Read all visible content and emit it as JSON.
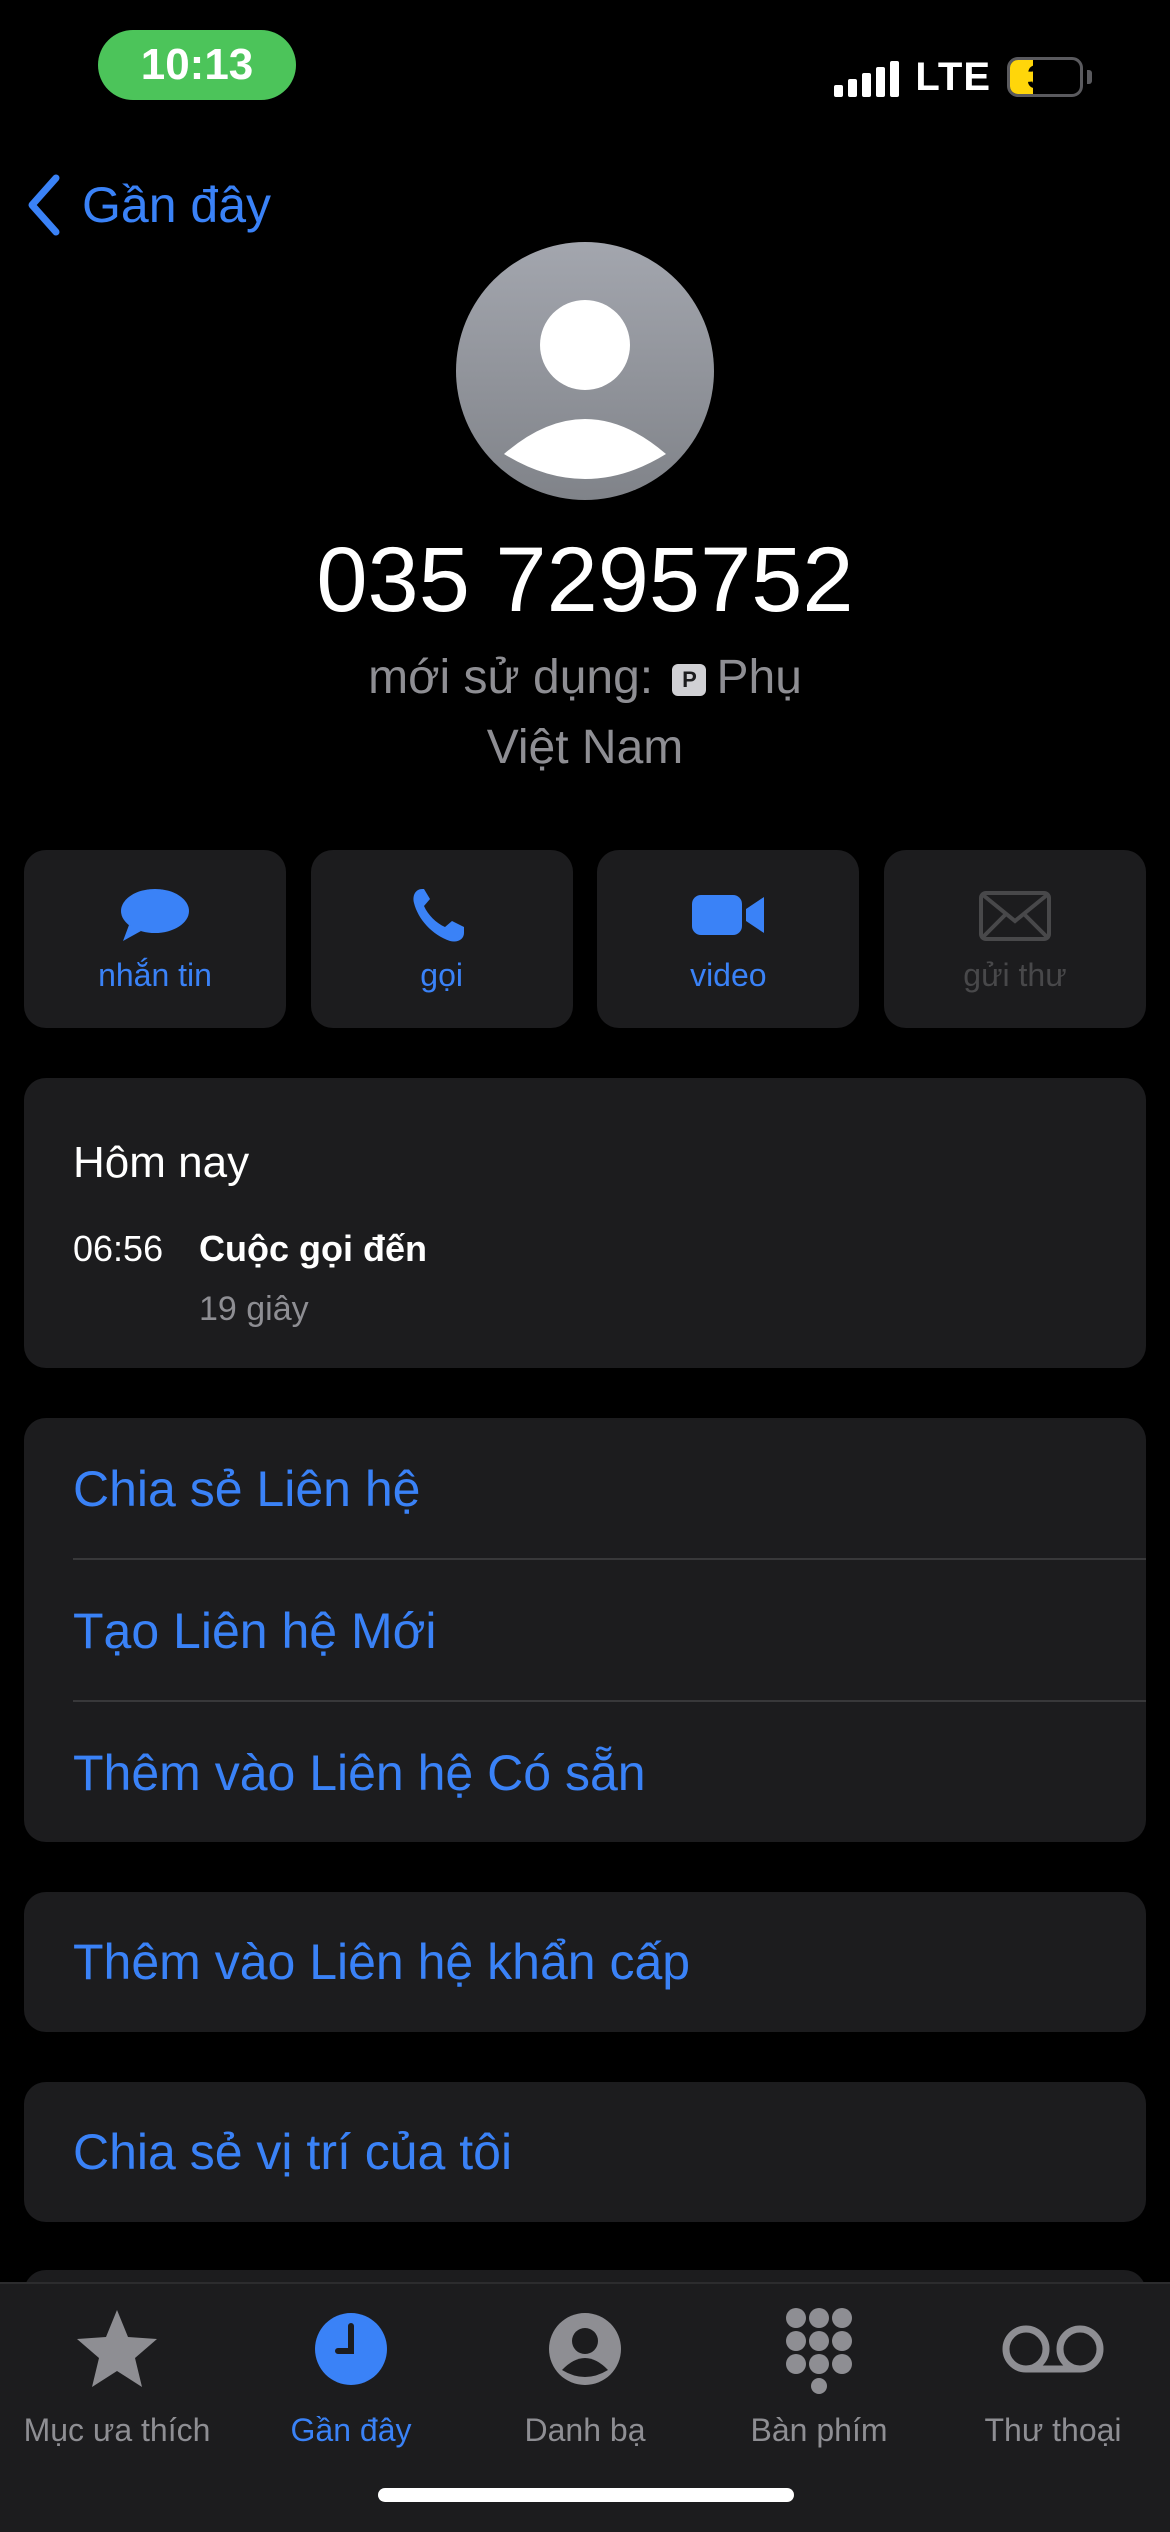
{
  "status_bar": {
    "time": "10:13",
    "network": "LTE",
    "battery_level": "33",
    "time_pill_color": "#4cc45a",
    "battery_color": "#ffd60a"
  },
  "nav": {
    "back_label": "Gần đây"
  },
  "contact": {
    "phone_number": "035 7295752",
    "line_label": "mới sử dụng:",
    "line_badge": "P",
    "line_name": "Phụ",
    "country": "Việt Nam",
    "avatar_icon": "person-silhouette-icon"
  },
  "actions": [
    {
      "label": "nhắn tin",
      "icon": "message-icon",
      "enabled": true
    },
    {
      "label": "gọi",
      "icon": "phone-icon",
      "enabled": true
    },
    {
      "label": "video",
      "icon": "video-icon",
      "enabled": true
    },
    {
      "label": "gửi thư",
      "icon": "mail-icon",
      "enabled": false
    }
  ],
  "recent_calls": {
    "day": "Hôm nay",
    "entries": [
      {
        "time": "06:56",
        "type": "Cuộc gọi đến",
        "duration": "19 giây"
      }
    ]
  },
  "menu": {
    "share_contact": "Chia sẻ Liên hệ",
    "create_contact": "Tạo Liên hệ Mới",
    "add_to_existing": "Thêm vào Liên hệ Có sẵn",
    "add_emergency": "Thêm vào Liên hệ khẩn cấp",
    "share_location": "Chia sẻ vị trí của tôi"
  },
  "tab_bar": {
    "tabs": [
      {
        "label": "Mục ưa thích",
        "icon": "star-icon",
        "active": false
      },
      {
        "label": "Gần đây",
        "icon": "clock-icon",
        "active": true
      },
      {
        "label": "Danh bạ",
        "icon": "contacts-icon",
        "active": false
      },
      {
        "label": "Bàn phím",
        "icon": "keypad-icon",
        "active": false
      },
      {
        "label": "Thư thoại",
        "icon": "voicemail-icon",
        "active": false
      }
    ]
  },
  "colors": {
    "accent": "#3a82f7",
    "background": "#000000",
    "card": "#1c1c1e",
    "secondary_text": "#8e8e93"
  }
}
